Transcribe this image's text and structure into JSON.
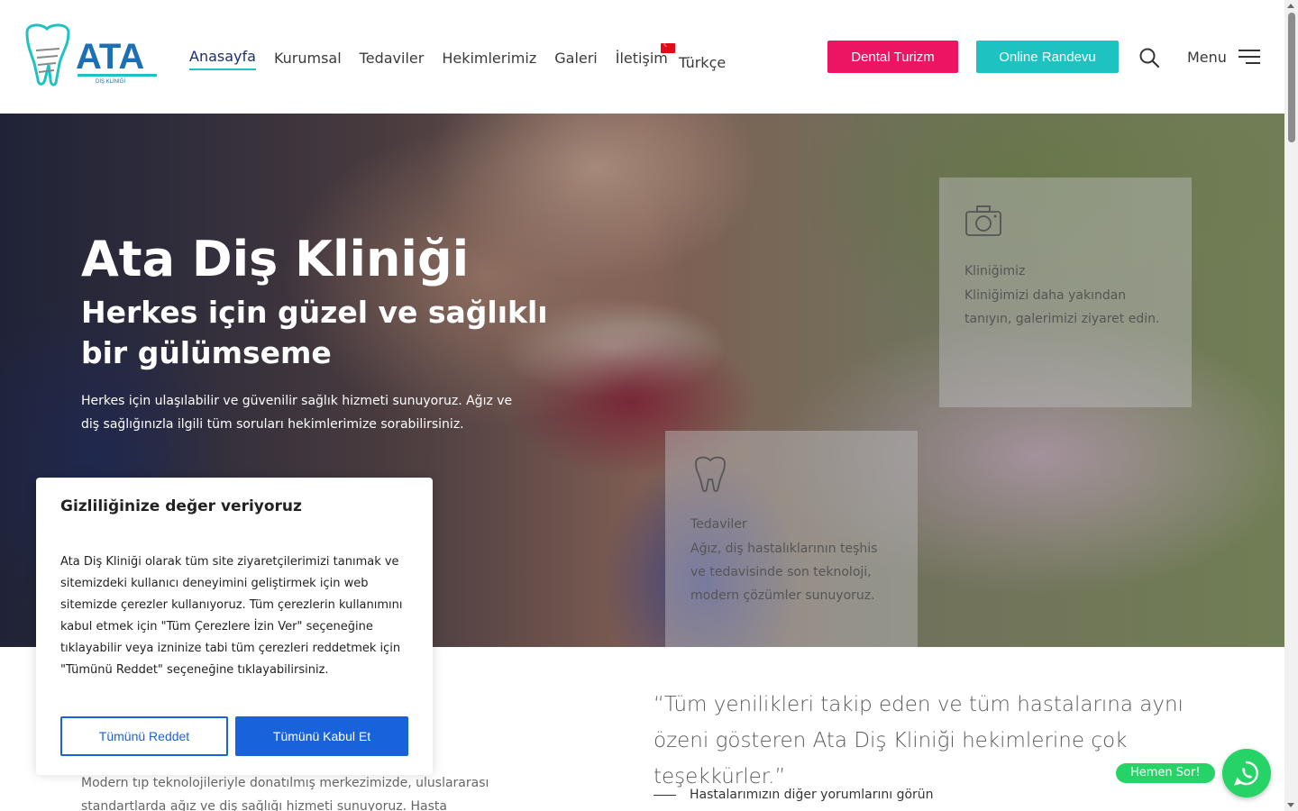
{
  "header": {
    "logo_text": "ATA",
    "logo_subtext": "DİŞ KLİNİĞİ",
    "nav": [
      {
        "label": "Anasayfa",
        "active": true
      },
      {
        "label": "Kurumsal"
      },
      {
        "label": "Tedaviler"
      },
      {
        "label": "Hekimlerimiz"
      },
      {
        "label": "Galeri"
      },
      {
        "label": "İletişim"
      }
    ],
    "language": "Türkçe",
    "dental_tourism_label": "Dental Turizm",
    "online_appointment_label": "Online Randevu",
    "menu_label": "Menu",
    "colors": {
      "pink": "#ec1563",
      "teal": "#1ec3c1"
    }
  },
  "hero": {
    "title": "Ata Diş Kliniği",
    "subtitle": "Herkes için güzel ve sağlıklı bir gülümseme",
    "text": "Herkes için ulaşılabilir ve güvenilir sağlık hizmeti sunuyoruz. Ağız ve diş sağlığınızla ilgili tüm soruları hekimlerimize sorabilirsiniz.",
    "cards": [
      {
        "icon": "camera-icon",
        "title": "Kliniğimiz",
        "text": "Kliniğimizi daha yakından tanıyın, galerimizi ziyaret edin."
      },
      {
        "icon": "tooth-icon",
        "title": "Tedaviler",
        "text": "Ağız, diş hastalıklarının teşhis ve tedavisinde son teknoloji, modern çözümler sunuyoruz."
      }
    ]
  },
  "content": {
    "quote": "“Tüm yenilikleri takip eden ve tüm hastalarına aynı özeni gösteren Ata Diş Kliniği hekimlerine çok teşekkürler.”",
    "reviews_link": "Hastalarımızın diğer yorumlarını görün",
    "left_text": "Modern tıp teknolojileriyle donatılmış merkezimizde, uluslararası standartlarda ağız ve diş sağlığı hizmeti sunuyoruz. Hasta memnuniyetini"
  },
  "cookie": {
    "title": "Gizliliğinize değer veriyoruz",
    "text": "Ata Diş Kliniği olarak tüm site ziyaretçilerimizi tanımak ve sitemizdeki kullanıcı deneyimini geliştirmek için web sitemizde çerezler kullanıyoruz. Tüm çerezlerin kullanımını kabul etmek için \"Tüm Çerezlere İzin Ver\" seçeneğine tıklayabilir veya izninize tabi tüm çerezleri reddetmek için \"Tümünü Reddet\" seçeneğine tıklayabilirsiniz.",
    "reject_label": "Tümünü Reddet",
    "accept_label": "Tümünü Kabul Et",
    "accent": "#1863dc"
  },
  "whatsapp": {
    "label": "Hemen Sor!",
    "icon": "whatsapp-icon",
    "color": "#25d366"
  }
}
